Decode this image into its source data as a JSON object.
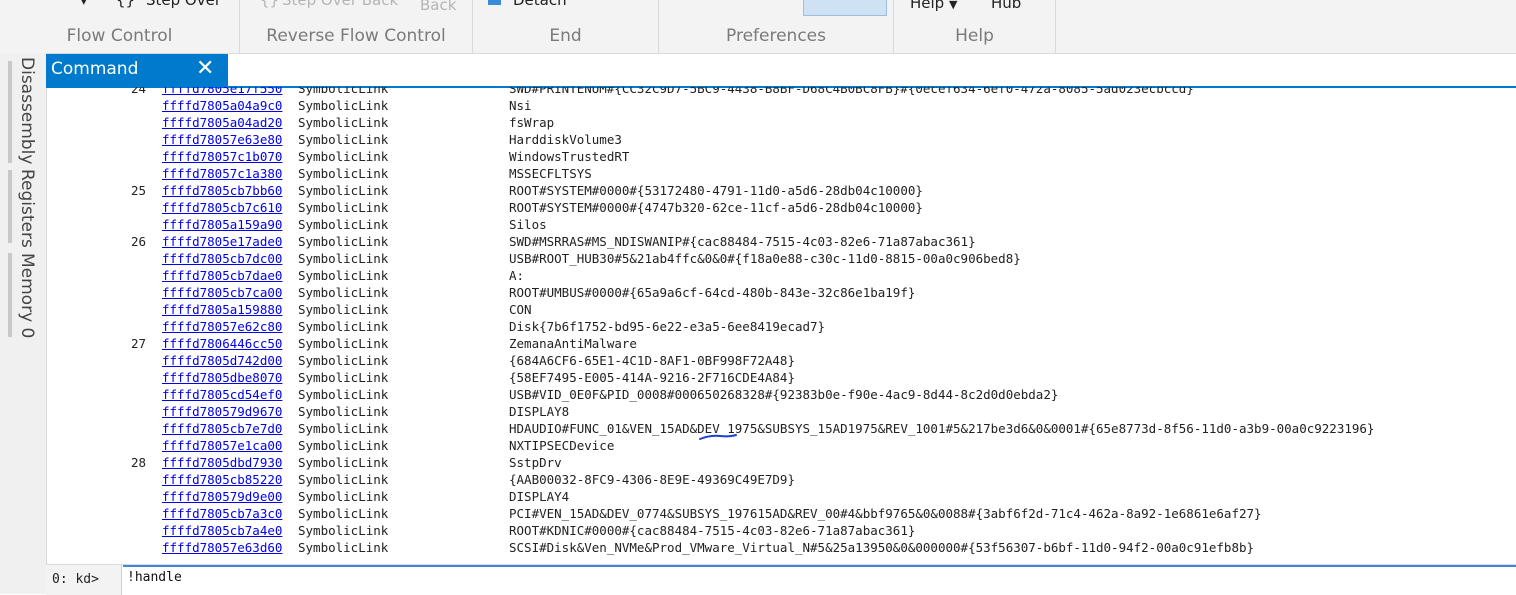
{
  "ribbon": {
    "step_over": "Step Over",
    "step_over_back": "Step Over Back",
    "back": "Back",
    "detach": "Detach",
    "help_menu": "Help",
    "hub": "Hub",
    "groups": {
      "flow_control": "Flow Control",
      "reverse_flow_control": "Reverse Flow Control",
      "end": "End",
      "preferences": "Preferences",
      "help": "Help"
    }
  },
  "side_tabs": [
    "Disassembly",
    "Registers",
    "Memory 0"
  ],
  "command_tab": {
    "label": "Command",
    "close": "✕"
  },
  "output_rows": [
    {
      "num": "24",
      "addr": "ffffd7805e17f550",
      "type": "SymbolicLink",
      "name": "SWD#PRINTENUM#{CC32C9D7-5BC9-4438-B8BF-D68C4B0BC8FB}#{0ecef634-6ef0-472a-8085-5ad023ecbccd}"
    },
    {
      "num": "",
      "addr": "ffffd7805a04a9c0",
      "type": "SymbolicLink",
      "name": "Nsi"
    },
    {
      "num": "",
      "addr": "ffffd7805a04ad20",
      "type": "SymbolicLink",
      "name": "fsWrap"
    },
    {
      "num": "",
      "addr": "ffffd78057e63e80",
      "type": "SymbolicLink",
      "name": "HarddiskVolume3"
    },
    {
      "num": "",
      "addr": "ffffd78057c1b070",
      "type": "SymbolicLink",
      "name": "WindowsTrustedRT"
    },
    {
      "num": "",
      "addr": "ffffd78057c1a380",
      "type": "SymbolicLink",
      "name": "MSSECFLTSYS"
    },
    {
      "num": "25",
      "addr": "ffffd7805cb7bb60",
      "type": "SymbolicLink",
      "name": "ROOT#SYSTEM#0000#{53172480-4791-11d0-a5d6-28db04c10000}"
    },
    {
      "num": "",
      "addr": "ffffd7805cb7c610",
      "type": "SymbolicLink",
      "name": "ROOT#SYSTEM#0000#{4747b320-62ce-11cf-a5d6-28db04c10000}"
    },
    {
      "num": "",
      "addr": "ffffd7805a159a90",
      "type": "SymbolicLink",
      "name": "Silos"
    },
    {
      "num": "26",
      "addr": "ffffd7805e17ade0",
      "type": "SymbolicLink",
      "name": "SWD#MSRRAS#MS_NDISWANIP#{cac88484-7515-4c03-82e6-71a87abac361}"
    },
    {
      "num": "",
      "addr": "ffffd7805cb7dc00",
      "type": "SymbolicLink",
      "name": "USB#ROOT_HUB30#5&21ab4ffc&0&0#{f18a0e88-c30c-11d0-8815-00a0c906bed8}"
    },
    {
      "num": "",
      "addr": "ffffd7805cb7dae0",
      "type": "SymbolicLink",
      "name": "A:"
    },
    {
      "num": "",
      "addr": "ffffd7805cb7ca00",
      "type": "SymbolicLink",
      "name": "ROOT#UMBUS#0000#{65a9a6cf-64cd-480b-843e-32c86e1ba19f}"
    },
    {
      "num": "",
      "addr": "ffffd7805a159880",
      "type": "SymbolicLink",
      "name": "CON"
    },
    {
      "num": "",
      "addr": "ffffd78057e62c80",
      "type": "SymbolicLink",
      "name": "Disk{7b6f1752-bd95-6e22-e3a5-6ee8419ecad7}"
    },
    {
      "num": "27",
      "addr": "ffffd7806446cc50",
      "type": "SymbolicLink",
      "name": "ZemanaAntiMalware"
    },
    {
      "num": "",
      "addr": "ffffd7805d742d00",
      "type": "SymbolicLink",
      "name": "{684A6CF6-65E1-4C1D-8AF1-0BF998F72A48}"
    },
    {
      "num": "",
      "addr": "ffffd7805dbe8070",
      "type": "SymbolicLink",
      "name": "{58EF7495-E005-414A-9216-2F716CDE4A84}"
    },
    {
      "num": "",
      "addr": "ffffd7805cd54ef0",
      "type": "SymbolicLink",
      "name": "USB#VID_0E0F&PID_0008#000650268328#{92383b0e-f90e-4ac9-8d44-8c2d0d0ebda2}"
    },
    {
      "num": "",
      "addr": "ffffd780579d9670",
      "type": "SymbolicLink",
      "name": "DISPLAY8"
    },
    {
      "num": "",
      "addr": "ffffd7805cb7e7d0",
      "type": "SymbolicLink",
      "name": "HDAUDIO#FUNC_01&VEN_15AD&DEV_1975&SUBSYS_15AD1975&REV_1001#5&217be3d6&0&0001#{65e8773d-8f56-11d0-a3b9-00a0c9223196}"
    },
    {
      "num": "",
      "addr": "ffffd78057e1ca00",
      "type": "SymbolicLink",
      "name": "NXTIPSECDevice"
    },
    {
      "num": "28",
      "addr": "ffffd7805dbd7930",
      "type": "SymbolicLink",
      "name": "SstpDrv"
    },
    {
      "num": "",
      "addr": "ffffd7805cb85220",
      "type": "SymbolicLink",
      "name": "{AAB00032-8FC9-4306-8E9E-49369C49E7D9}"
    },
    {
      "num": "",
      "addr": "ffffd780579d9e00",
      "type": "SymbolicLink",
      "name": "DISPLAY4"
    },
    {
      "num": "",
      "addr": "ffffd7805cb7a3c0",
      "type": "SymbolicLink",
      "name": "PCI#VEN_15AD&DEV_0774&SUBSYS_197615AD&REV_00#4&bbf9765&0&0088#{3abf6f2d-71c4-462a-8a92-1e6861e6af27}"
    },
    {
      "num": "",
      "addr": "ffffd7805cb7a4e0",
      "type": "SymbolicLink",
      "name": "ROOT#KDNIC#0000#{cac88484-7515-4c03-82e6-71a87abac361}"
    },
    {
      "num": "",
      "addr": "ffffd78057e63d60",
      "type": "SymbolicLink",
      "name": "SCSI#Disk&Ven_NVMe&Prod_VMware_Virtual_N#5&25a13950&0&000000#{53f56307-b6bf-11d0-94f2-00a0c91efb8b}"
    }
  ],
  "input": {
    "prompt": "0: kd>",
    "value": "!handle"
  }
}
